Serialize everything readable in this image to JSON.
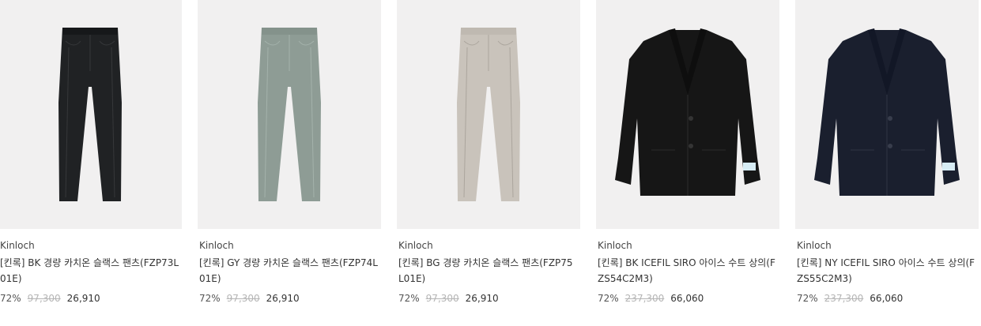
{
  "products": [
    {
      "brand": "Kinloch",
      "name": "[킨록] BK 경량 카치온 슬랙스 팬츠(FZP73L01E)",
      "discount": "72%",
      "original_price": "97,300",
      "sale_price": "26,910",
      "item_type": "pants",
      "item_color": "#202224"
    },
    {
      "brand": "Kinloch",
      "name": "[킨록] GY 경량 카치온 슬랙스 팬츠(FZP74L01E)",
      "discount": "72%",
      "original_price": "97,300",
      "sale_price": "26,910",
      "item_type": "pants",
      "item_color": "#8e9c95"
    },
    {
      "brand": "Kinloch",
      "name": "[킨록] BG 경량 카치온 슬랙스 팬츠(FZP75L01E)",
      "discount": "72%",
      "original_price": "97,300",
      "sale_price": "26,910",
      "item_type": "pants",
      "item_color": "#c9c3bb"
    },
    {
      "brand": "Kinloch",
      "name": "[킨록] BK ICEFIL SIRO 아이스 수트 상의(FZS54C2M3)",
      "discount": "72%",
      "original_price": "237,300",
      "sale_price": "66,060",
      "item_type": "jacket",
      "item_color": "#161616"
    },
    {
      "brand": "Kinloch",
      "name": "[킨록] NY ICEFIL SIRO 아이스 수트 상의(FZS55C2M3)",
      "discount": "72%",
      "original_price": "237,300",
      "sale_price": "66,060",
      "item_type": "jacket",
      "item_color": "#1a1f2e"
    }
  ]
}
